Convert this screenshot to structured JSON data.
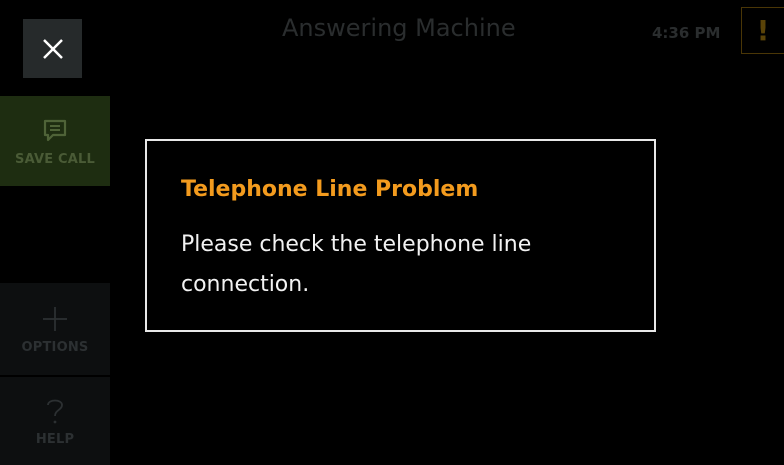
{
  "header": {
    "title": "Answering Machine",
    "time": "4:36 PM",
    "alert_symbol": "!",
    "close_icon": "close-icon",
    "alert_icon": "alert-icon"
  },
  "sidebar": {
    "items": [
      {
        "label": "SAVE CALL",
        "icon": "save-message-icon"
      },
      {
        "label": "OPTIONS",
        "icon": "plus-icon"
      },
      {
        "label": "HELP",
        "icon": "question-icon"
      }
    ]
  },
  "dialog": {
    "title": "Telephone Line Problem",
    "message": "Please check the telephone line connection."
  },
  "colors": {
    "background": "#000000",
    "dialog_title": "#f39b1e",
    "dialog_border": "#e8e8e8",
    "save_call_bg": "#1e2d11"
  }
}
